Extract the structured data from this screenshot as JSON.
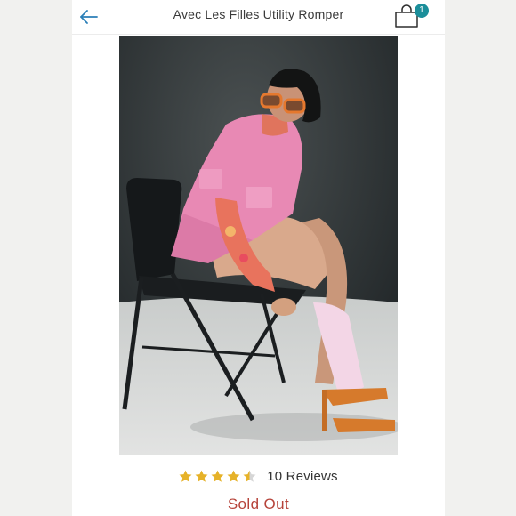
{
  "header": {
    "title": "Avec Les Filles Utility Romper",
    "back_icon": "arrow-left-icon",
    "bag_icon": "shopping-bag-icon",
    "bag_count": "1"
  },
  "product": {
    "image_alt": "Model in pink utility romper seated on a folding chair",
    "rating": 4.5,
    "rating_max": 5,
    "reviews_label": "10 Reviews",
    "status": "Sold Out"
  },
  "colors": {
    "accent": "#1b8e9a",
    "star": "#e6b229",
    "sold_out": "#b6433a",
    "romper": "#e889b4"
  }
}
